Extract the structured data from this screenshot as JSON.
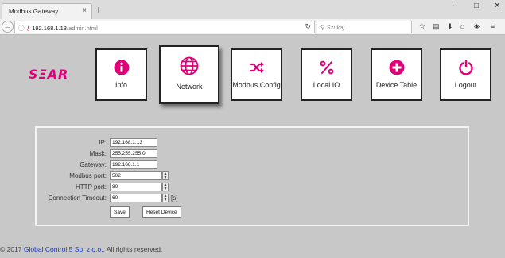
{
  "browser": {
    "tab_title": "Modbus Gateway",
    "tab_close": "×",
    "new_tab": "+",
    "window_controls": [
      "–",
      "□",
      "✕"
    ],
    "url_host": "192.168.1.13",
    "url_path": "/admin.html",
    "search_placeholder": "Szukaj"
  },
  "brand": {
    "logo_text": "SΞAR",
    "accent_color": "#e2007a"
  },
  "nav": [
    {
      "id": "info",
      "label": "Info",
      "icon": "info-icon"
    },
    {
      "id": "network",
      "label": "Network",
      "icon": "globe-icon",
      "active": true
    },
    {
      "id": "modbus-config",
      "label": "Modbus Config",
      "icon": "shuffle-icon"
    },
    {
      "id": "local-io",
      "label": "Local IO",
      "icon": "percent-icon"
    },
    {
      "id": "device-table",
      "label": "Device Table",
      "icon": "plus-circle-icon"
    },
    {
      "id": "logout",
      "label": "Logout",
      "icon": "power-icon"
    }
  ],
  "form": {
    "ip": {
      "label": "IP:",
      "value": "192.168.1.13"
    },
    "mask": {
      "label": "Mask:",
      "value": "255.255.255.0"
    },
    "gateway": {
      "label": "Gateway:",
      "value": "192.168.1.1"
    },
    "modbus_port": {
      "label": "Modbus port:",
      "value": "502"
    },
    "http_port": {
      "label": "HTTP port:",
      "value": "80"
    },
    "timeout": {
      "label": "Connection Timeout:",
      "value": "60",
      "unit": "[s]"
    },
    "save_label": "Save",
    "reset_label": "Reset Device"
  },
  "footer": {
    "prefix": "© 2017",
    "company": "Global Control 5 Sp. z o.o.",
    "suffix": "All rights reserved."
  }
}
